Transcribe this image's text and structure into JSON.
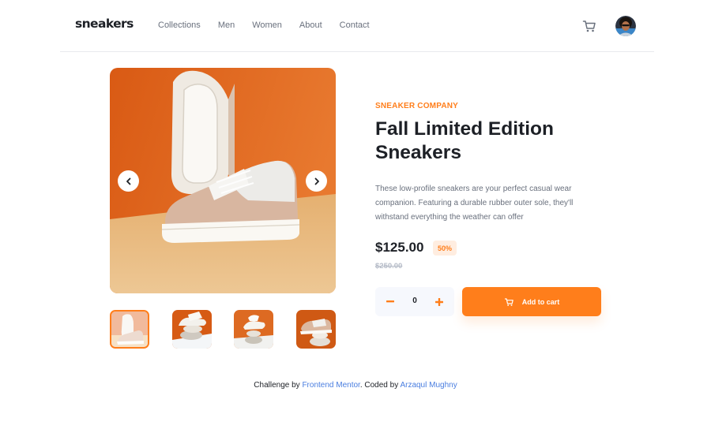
{
  "header": {
    "logo": "sneakers",
    "nav": [
      "Collections",
      "Men",
      "Women",
      "About",
      "Contact"
    ]
  },
  "gallery": {
    "prev_icon": "chevron-left-icon",
    "next_icon": "chevron-right-icon",
    "thumbnails": [
      "thumbnail-1",
      "thumbnail-2",
      "thumbnail-3",
      "thumbnail-4"
    ],
    "active_thumbnail": 1
  },
  "product": {
    "company": "SNEAKER COMPANY",
    "title": "Fall Limited Edition Sneakers",
    "description": "These low-profile sneakers are your perfect casual wear companion. Featuring a durable rubber outer sole, they'll withstand everything the weather can offer",
    "price": "$125.00",
    "discount": "50%",
    "old_price": "$250.00"
  },
  "cart": {
    "quantity": "0",
    "add_label": "Add to cart"
  },
  "footer": {
    "prefix": "Challenge by",
    "link1": "Frontend Mentor",
    "middle": ". Coded by",
    "link2": "Arzaqul Mughny"
  },
  "colors": {
    "accent": "#ff7e1b",
    "accent_pale": "#ffede0",
    "text_dark": "#1d2026",
    "text_gray": "#69707d",
    "link": "#4a7ee0"
  }
}
